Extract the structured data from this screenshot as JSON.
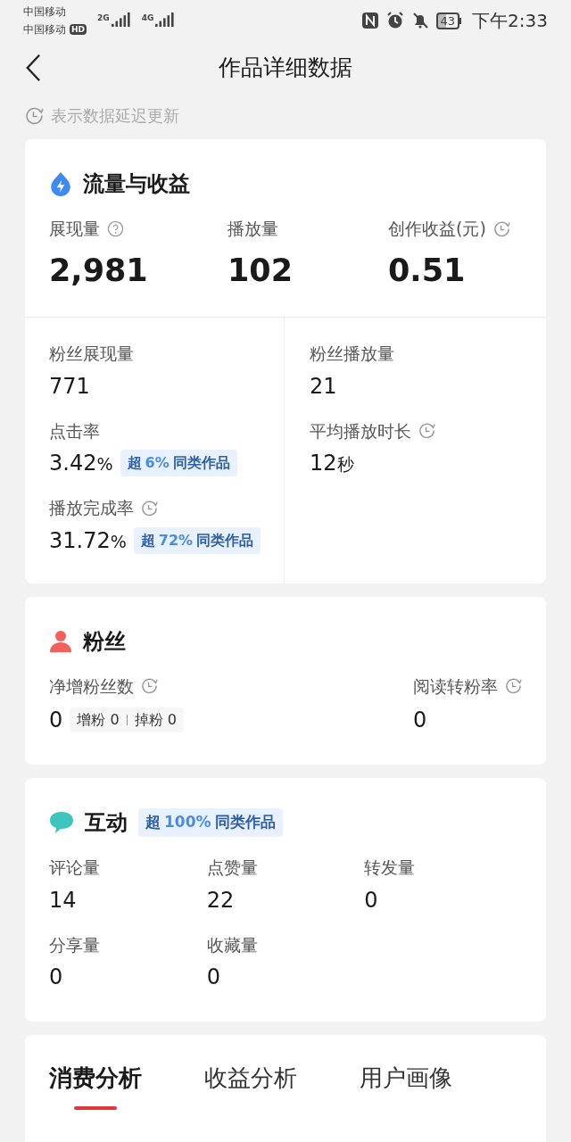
{
  "status_bar": {
    "carriers": [
      {
        "name": "中国移动",
        "hd": false
      },
      {
        "name": "中国移动",
        "hd": true
      }
    ],
    "hd_label": "HD",
    "networks": [
      "2G",
      "4G"
    ],
    "battery": "43",
    "time": "下午2:33"
  },
  "header": {
    "title": "作品详细数据"
  },
  "notice": "表示数据延迟更新",
  "traffic": {
    "title": "流量与收益",
    "top": [
      {
        "label": "展现量",
        "value": "2,981",
        "help": true,
        "delayed": false
      },
      {
        "label": "播放量",
        "value": "102",
        "help": false,
        "delayed": false
      },
      {
        "label": "创作收益(元)",
        "value": "0.51",
        "help": false,
        "delayed": true
      }
    ],
    "left": [
      {
        "label": "粉丝展现量",
        "value": "771",
        "delayed": false
      },
      {
        "label": "点击率",
        "value": "3.42",
        "unit": "%",
        "delayed": false,
        "badge": {
          "prefix": "超",
          "value": "6%",
          "suffix": "同类作品"
        }
      },
      {
        "label": "播放完成率",
        "value": "31.72",
        "unit": "%",
        "delayed": true,
        "badge": {
          "prefix": "超",
          "value": "72%",
          "suffix": "同类作品"
        }
      }
    ],
    "right": [
      {
        "label": "粉丝播放量",
        "value": "21",
        "delayed": false
      },
      {
        "label": "平均播放时长",
        "value": "12",
        "unit": "秒",
        "delayed": true
      }
    ]
  },
  "fans": {
    "title": "粉丝",
    "metrics": [
      {
        "label": "净增粉丝数",
        "value": "0",
        "delayed": true,
        "detail": [
          {
            "label": "增粉",
            "value": "0"
          },
          {
            "label": "掉粉",
            "value": "0"
          }
        ]
      },
      {
        "label": "阅读转粉率",
        "value": "0",
        "delayed": true
      }
    ]
  },
  "interaction": {
    "title": "互动",
    "badge": {
      "prefix": "超",
      "value": "100%",
      "suffix": "同类作品"
    },
    "metrics": [
      {
        "label": "评论量",
        "value": "14"
      },
      {
        "label": "点赞量",
        "value": "22"
      },
      {
        "label": "转发量",
        "value": "0"
      },
      {
        "label": "分享量",
        "value": "0"
      },
      {
        "label": "收藏量",
        "value": "0"
      }
    ]
  },
  "tabs": [
    {
      "label": "消费分析",
      "selected": true
    },
    {
      "label": "收益分析",
      "selected": false
    },
    {
      "label": "用户画像",
      "selected": false
    }
  ]
}
